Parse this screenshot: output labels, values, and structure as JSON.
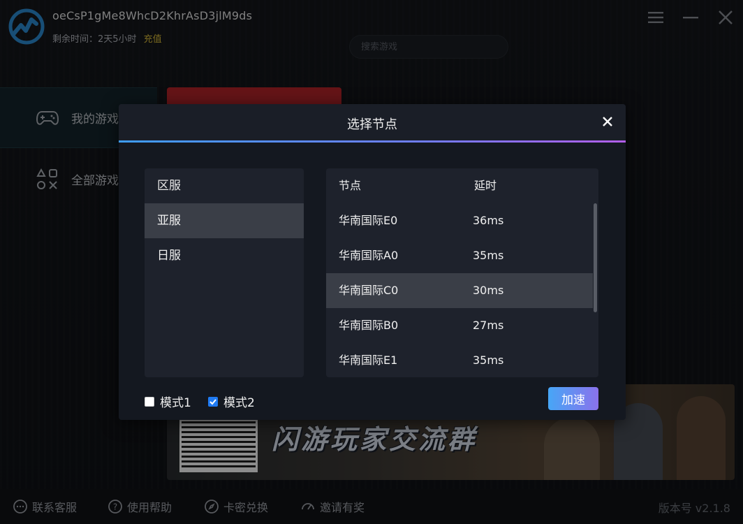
{
  "header": {
    "user_id": "oeCsP1gMe8WhcD2KhrAsD3jlM9ds",
    "remaining_label": "剩余时间：",
    "remaining_value": "2天5小时",
    "recharge_label": "充值",
    "search_placeholder": "搜索游戏"
  },
  "sidebar": {
    "items": [
      {
        "label": "我的游戏",
        "icon": "gamepad-icon",
        "active": true
      },
      {
        "label": "全部游戏",
        "icon": "apps-grid-icon",
        "active": false
      }
    ]
  },
  "banner": {
    "title": "闪游玩家交流群"
  },
  "footer": {
    "links": [
      {
        "label": "联系客服",
        "icon": "chat-icon"
      },
      {
        "label": "使用帮助",
        "icon": "help-icon"
      },
      {
        "label": "卡密兑换",
        "icon": "compass-icon"
      },
      {
        "label": "邀请有奖",
        "icon": "gauge-icon"
      }
    ],
    "version": "版本号 v2.1.8"
  },
  "modal": {
    "title": "选择节点",
    "region_header": "区服",
    "regions": [
      {
        "label": "亚服",
        "selected": true
      },
      {
        "label": "日服",
        "selected": false
      }
    ],
    "node_header": "节点",
    "latency_header": "延时",
    "nodes": [
      {
        "name": "华南国际E0",
        "latency": "36ms",
        "selected": false
      },
      {
        "name": "华南国际A0",
        "latency": "35ms",
        "selected": false
      },
      {
        "name": "华南国际C0",
        "latency": "30ms",
        "selected": true
      },
      {
        "name": "华南国际B0",
        "latency": "27ms",
        "selected": false
      },
      {
        "name": "华南国际E1",
        "latency": "35ms",
        "selected": false
      }
    ],
    "mode1_label": "模式1",
    "mode1_checked": false,
    "mode2_label": "模式2",
    "mode2_checked": true,
    "accelerate_label": "加速"
  },
  "colors": {
    "accent_gradient_start": "#3e9cf5",
    "accent_gradient_end": "#b25ee8",
    "recharge": "#e0c13a",
    "checkbox_checked": "#1f7af2"
  }
}
